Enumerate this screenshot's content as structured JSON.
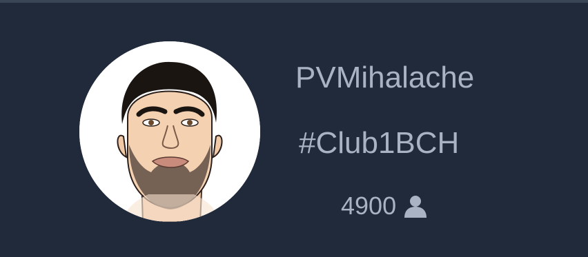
{
  "profile": {
    "username": "PVMihalache",
    "club_tag": "#Club1BCH",
    "followers_count": "4900",
    "followers_icon": "user-icon",
    "avatar_icon": "avatar-portrait"
  },
  "colors": {
    "background": "#202a3b",
    "text": "#a9b3c4",
    "avatar_bg": "#ffffff"
  }
}
